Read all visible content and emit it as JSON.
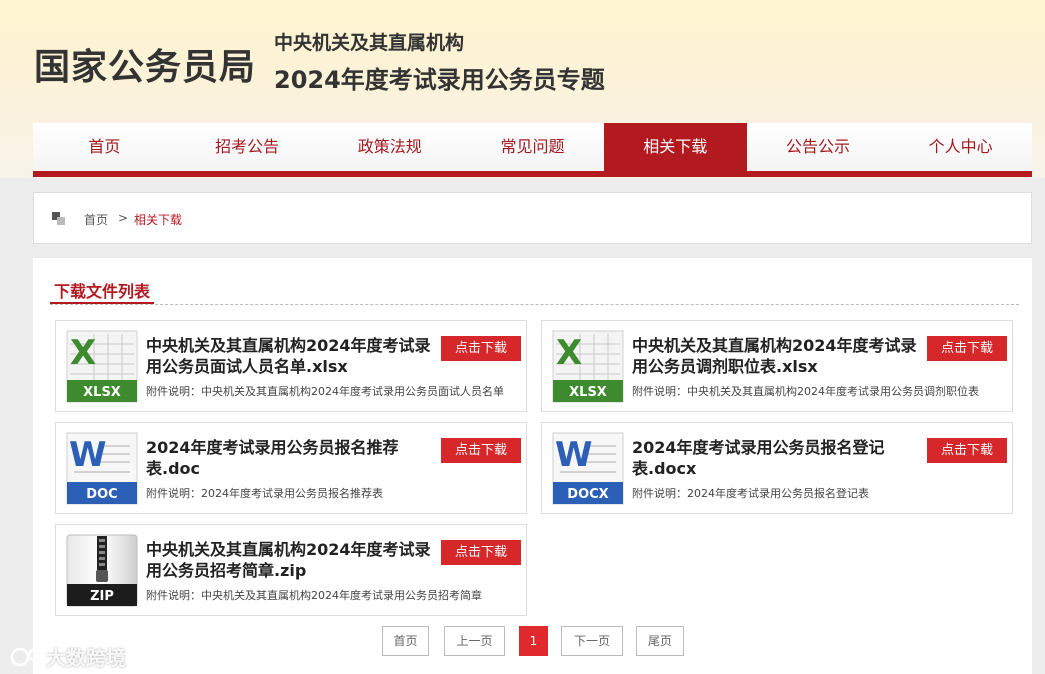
{
  "header": {
    "logo": "国家公务员局",
    "subtitle1": "中央机关及其直属机构",
    "subtitle2": "2024年度考试录用公务员专题"
  },
  "nav": {
    "items": [
      {
        "label": "首页"
      },
      {
        "label": "招考公告"
      },
      {
        "label": "政策法规"
      },
      {
        "label": "常见问题"
      },
      {
        "label": "相关下载"
      },
      {
        "label": "公告公示"
      },
      {
        "label": "个人中心"
      }
    ],
    "active": "相关下载"
  },
  "breadcrumb": {
    "home": "首页",
    "separator": ">",
    "current": "相关下载"
  },
  "section": {
    "title": "下载文件列表"
  },
  "files": [
    {
      "type": "XLSX",
      "icon": "excel-file-icon",
      "name": "中央机关及其直属机构2024年度考试录用公务员面试人员名单.xlsx",
      "desc": "附件说明：中央机关及其直属机构2024年度考试录用公务员面试人员名单",
      "button": "点击下载"
    },
    {
      "type": "XLSX",
      "icon": "excel-file-icon",
      "name": "中央机关及其直属机构2024年度考试录用公务员调剂职位表.xlsx",
      "desc": "附件说明：中央机关及其直属机构2024年度考试录用公务员调剂职位表",
      "button": "点击下载"
    },
    {
      "type": "DOC",
      "icon": "word-file-icon",
      "name": "2024年度考试录用公务员报名推荐表.doc",
      "desc": "附件说明：2024年度考试录用公务员报名推荐表",
      "button": "点击下载"
    },
    {
      "type": "DOCX",
      "icon": "word-file-icon",
      "name": "2024年度考试录用公务员报名登记表.docx",
      "desc": "附件说明：2024年度考试录用公务员报名登记表",
      "button": "点击下载"
    },
    {
      "type": "ZIP",
      "icon": "zip-file-icon",
      "name": "中央机关及其直属机构2024年度考试录用公务员招考简章.zip",
      "desc": "附件说明：中央机关及其直属机构2024年度考试录用公务员招考简章",
      "button": "点击下载"
    }
  ],
  "pagination": {
    "first": "首页",
    "prev": "上一页",
    "current": "1",
    "next": "下一页",
    "last": "尾页"
  },
  "watermark": "大数跨境",
  "colors": {
    "brand_red": "#b31a20",
    "button_red": "#d6282a",
    "excel_green": "#3d8a2f",
    "word_blue": "#2c5fb6"
  }
}
